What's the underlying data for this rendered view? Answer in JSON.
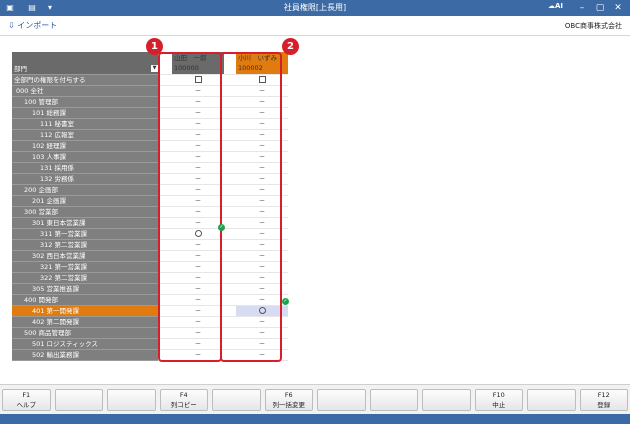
{
  "window": {
    "title": "社員権限[上長用]",
    "logo_text": "AI"
  },
  "toolbar": {
    "import_label": "インポート",
    "company": "OBC商事株式会社"
  },
  "grid": {
    "dept_header": "部門",
    "all_depts_label": "全部門の権限を付与する",
    "users": [
      {
        "name": "山田　一郎",
        "code": "100000"
      },
      {
        "name": "小川　いずみ",
        "code": "100002"
      }
    ],
    "rows": [
      {
        "label": "000 全社",
        "indent": 1,
        "u1": "－",
        "u2": "－"
      },
      {
        "label": "100 管理部",
        "indent": 2,
        "u1": "－",
        "u2": "－"
      },
      {
        "label": "101 総務課",
        "indent": 3,
        "u1": "－",
        "u2": "－"
      },
      {
        "label": "111 秘書室",
        "indent": 4,
        "u1": "－",
        "u2": "－"
      },
      {
        "label": "112 広報室",
        "indent": 4,
        "u1": "－",
        "u2": "－"
      },
      {
        "label": "102 経理課",
        "indent": 3,
        "u1": "－",
        "u2": "－"
      },
      {
        "label": "103 人事課",
        "indent": 3,
        "u1": "－",
        "u2": "－"
      },
      {
        "label": "131 採用係",
        "indent": 4,
        "u1": "－",
        "u2": "－"
      },
      {
        "label": "132 労務係",
        "indent": 4,
        "u1": "－",
        "u2": "－"
      },
      {
        "label": "200 企画部",
        "indent": 2,
        "u1": "－",
        "u2": "－"
      },
      {
        "label": "201 企画課",
        "indent": 3,
        "u1": "－",
        "u2": "－"
      },
      {
        "label": "300 営業部",
        "indent": 2,
        "u1": "－",
        "u2": "－"
      },
      {
        "label": "301 東日本営業課",
        "indent": 3,
        "u1": "－",
        "u2": "－"
      },
      {
        "label": "311 第一営業課",
        "indent": 4,
        "u1": "○",
        "u2": "－"
      },
      {
        "label": "312 第二営業課",
        "indent": 4,
        "u1": "－",
        "u2": "－"
      },
      {
        "label": "302 西日本営業課",
        "indent": 3,
        "u1": "－",
        "u2": "－"
      },
      {
        "label": "321 第一営業課",
        "indent": 4,
        "u1": "－",
        "u2": "－"
      },
      {
        "label": "322 第二営業課",
        "indent": 4,
        "u1": "－",
        "u2": "－"
      },
      {
        "label": "305 営業推進課",
        "indent": 3,
        "u1": "－",
        "u2": "－"
      },
      {
        "label": "400 開発部",
        "indent": 2,
        "u1": "－",
        "u2": "－"
      },
      {
        "label": "401 第一開発課",
        "indent": 3,
        "u1": "－",
        "u2": "○"
      },
      {
        "label": "402 第二開発課",
        "indent": 3,
        "u1": "－",
        "u2": "－"
      },
      {
        "label": "500 商品管理部",
        "indent": 2,
        "u1": "－",
        "u2": "－"
      },
      {
        "label": "501 ロジスティックス",
        "indent": 3,
        "u1": "－",
        "u2": "－"
      },
      {
        "label": "502 輸出業務課",
        "indent": 3,
        "u1": "－",
        "u2": "－"
      }
    ],
    "selected_row": 20
  },
  "callouts": [
    "1",
    "2"
  ],
  "fkeys": [
    {
      "key": "F1",
      "label": "ヘルプ"
    },
    {
      "key": "",
      "label": ""
    },
    {
      "key": "",
      "label": ""
    },
    {
      "key": "F4",
      "label": "列コピー"
    },
    {
      "key": "",
      "label": ""
    },
    {
      "key": "F6",
      "label": "列一括変更"
    },
    {
      "key": "",
      "label": ""
    },
    {
      "key": "",
      "label": ""
    },
    {
      "key": "",
      "label": ""
    },
    {
      "key": "F10",
      "label": "中止"
    },
    {
      "key": "",
      "label": ""
    },
    {
      "key": "F12",
      "label": "登録"
    }
  ],
  "colors": {
    "titlebar": "#3b6aa5",
    "selected_orange": "#e07b10",
    "dept_gray": "#7f7f7f",
    "highlight_red": "#d61f2b",
    "ok_green": "#1aa34a"
  }
}
